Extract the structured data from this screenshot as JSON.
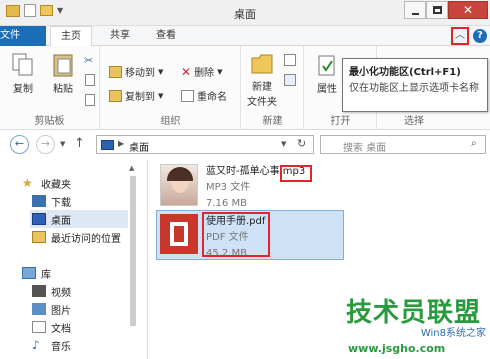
{
  "window": {
    "title": "桌面"
  },
  "ribbon_tabs": [
    "文件",
    "主页",
    "共享",
    "查看"
  ],
  "ribbon": {
    "clipboard": {
      "copy": "复制",
      "paste": "粘贴",
      "label": "剪贴板"
    },
    "organize": {
      "move_to": "移动到",
      "copy_to": "复制到",
      "delete": "删除",
      "rename": "重命名",
      "label": "组织"
    },
    "new": {
      "new_folder_line1": "新建",
      "new_folder_line2": "文件夹",
      "label": "新建"
    },
    "open": {
      "properties": "属性",
      "label": "打开"
    },
    "select": {
      "label": "选择"
    }
  },
  "tooltip": {
    "title": "最小化功能区(Ctrl+F1)",
    "desc": "仅在功能区上显示选项卡名称"
  },
  "address": {
    "path": "桌面",
    "search_placeholder": "搜索 桌面"
  },
  "nav": {
    "favorites": "收藏夹",
    "downloads": "下载",
    "desktop": "桌面",
    "recent": "最近访问的位置",
    "libraries": "库",
    "videos": "视频",
    "pictures": "图片",
    "documents": "文档",
    "music": "音乐"
  },
  "files": [
    {
      "name_main": "蓝又时-孤单心事",
      "name_ext": ".mp3",
      "type": "MP3 文件",
      "size": "7.16 MB"
    },
    {
      "name_main": "使用手册.pdf",
      "name_ext": "",
      "type": "PDF 文件",
      "size": "45.2 MB"
    }
  ],
  "watermark": {
    "text": "技术员联盟",
    "sub": "www.jsgho.com",
    "tag": "Win8系统之家"
  },
  "colors": {
    "accent": "#1c6db7",
    "highlight": "#e0262b",
    "selection": "#cde1f7"
  }
}
